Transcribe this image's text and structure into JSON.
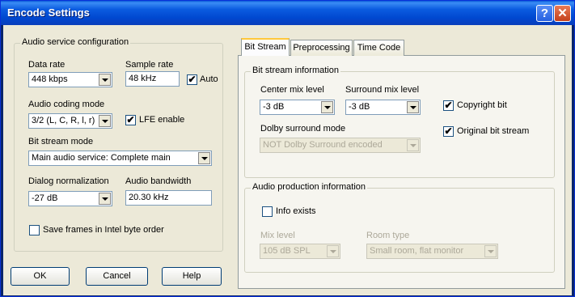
{
  "window": {
    "title": "Encode Settings",
    "help_glyph": "?",
    "close_glyph": "✕"
  },
  "left": {
    "group_title": "Audio service configuration",
    "data_rate": {
      "label": "Data rate",
      "value": "448 kbps"
    },
    "sample_rate": {
      "label": "Sample rate",
      "value": "48 kHz"
    },
    "auto": {
      "label": "Auto",
      "checked": true
    },
    "audio_coding_mode": {
      "label": "Audio coding mode",
      "value": "3/2 (L, C, R, l, r)"
    },
    "lfe": {
      "label": "LFE enable",
      "checked": true
    },
    "bit_stream_mode": {
      "label": "Bit stream mode",
      "value": "Main audio service: Complete main"
    },
    "dialog_norm": {
      "label": "Dialog normalization",
      "value": "-27 dB"
    },
    "audio_bandwidth": {
      "label": "Audio bandwidth",
      "value": "20.30 kHz"
    },
    "save_frames": {
      "label": "Save frames in Intel byte order",
      "checked": false
    }
  },
  "buttons": {
    "ok": "OK",
    "cancel": "Cancel",
    "help": "Help"
  },
  "tabs": [
    "Bit Stream",
    "Preprocessing",
    "Time Code"
  ],
  "bitstream": {
    "group_title": "Bit stream information",
    "center_mix": {
      "label": "Center mix level",
      "value": "-3 dB"
    },
    "surround_mix": {
      "label": "Surround mix level",
      "value": "-3 dB"
    },
    "copyright": {
      "label": "Copyright bit",
      "checked": true
    },
    "original": {
      "label": "Original bit stream",
      "checked": true
    },
    "dolby_surround": {
      "label": "Dolby surround mode",
      "value": "NOT Dolby Surround encoded"
    }
  },
  "production": {
    "group_title": "Audio production information",
    "info_exists": {
      "label": "Info exists",
      "checked": false
    },
    "mix_level": {
      "label": "Mix level",
      "value": "105 dB SPL"
    },
    "room_type": {
      "label": "Room type",
      "value": "Small room, flat monitor"
    }
  },
  "check_glyph": "✔"
}
